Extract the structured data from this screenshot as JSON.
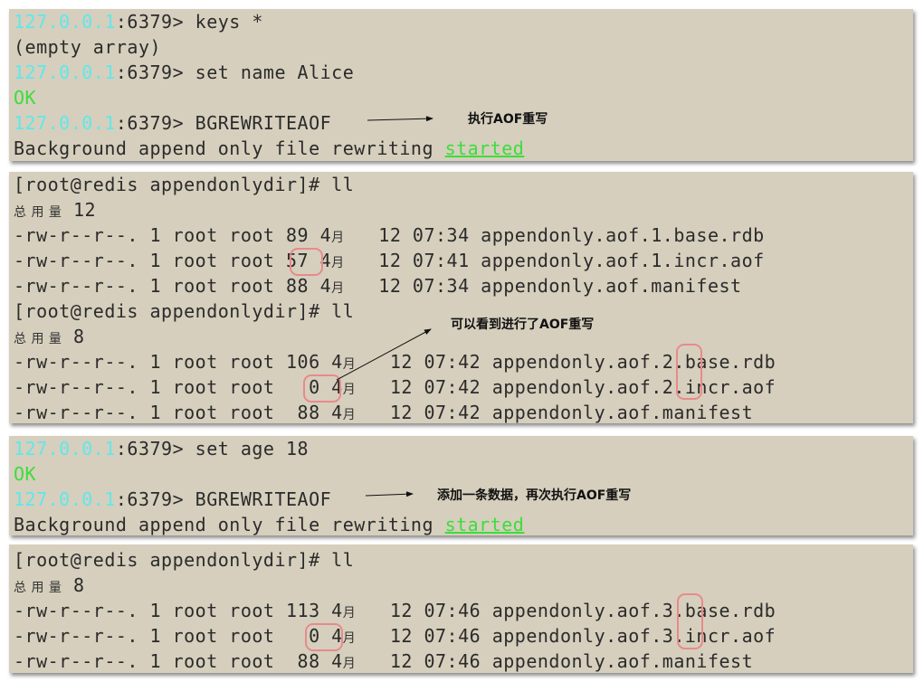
{
  "panel1": {
    "l1": {
      "ip": "127.0.0.1",
      "rest": ":6379> keys *"
    },
    "l2": "(empty array)",
    "l3": {
      "ip": "127.0.0.1",
      "rest": ":6379> set name Alice"
    },
    "l4": "OK",
    "l5": {
      "ip": "127.0.0.1",
      "rest": ":6379> BGREWRITEAOF"
    },
    "l6": {
      "text": "Background append only file rewriting ",
      "started": "started"
    }
  },
  "panel2": {
    "prompt1": "[root@redis appendonlydir]# ll",
    "total1": {
      "label": "总 用 量",
      "num": " 12"
    },
    "f1": {
      "pre": "-rw-r--r--. 1 root root 89 4",
      "mon": "月",
      "post": "   12 07:34 appendonly.aof.1.base.rdb"
    },
    "f2": {
      "pre": "-rw-r--r--. 1 root root 57 4",
      "mon": "月",
      "post": "   12 07:41 appendonly.aof.1.incr.aof"
    },
    "f3": {
      "pre": "-rw-r--r--. 1 root root 88 4",
      "mon": "月",
      "post": "   12 07:34 appendonly.aof.manifest"
    },
    "prompt2": "[root@redis appendonlydir]# ll",
    "total2": {
      "label": "总 用 量",
      "num": " 8"
    },
    "f4": {
      "pre": "-rw-r--r--. 1 root root 106 4",
      "mon": "月",
      "post": "   12 07:42 appendonly.aof.2.base.rdb"
    },
    "f5": {
      "pre": "-rw-r--r--. 1 root root   0 4",
      "mon": "月",
      "post": "   12 07:42 appendonly.aof.2.incr.aof"
    },
    "f6": {
      "pre": "-rw-r--r--. 1 root root  88 4",
      "mon": "月",
      "post": "   12 07:42 appendonly.aof.manifest"
    }
  },
  "panel3": {
    "l1": {
      "ip": "127.0.0.1",
      "rest": ":6379> set age 18"
    },
    "l2": "OK",
    "l3": {
      "ip": "127.0.0.1",
      "rest": ":6379> BGREWRITEAOF"
    },
    "l4": {
      "text": "Background append only file rewriting ",
      "started": "started"
    }
  },
  "panel4": {
    "prompt": "[root@redis appendonlydir]# ll",
    "total": {
      "label": "总 用 量",
      "num": " 8"
    },
    "f1": {
      "pre": "-rw-r--r--. 1 root root 113 4",
      "mon": "月",
      "post": "   12 07:46 appendonly.aof.3.base.rdb"
    },
    "f2": {
      "pre": "-rw-r--r--. 1 root root   0 4",
      "mon": "月",
      "post": "   12 07:46 appendonly.aof.3.incr.aof"
    },
    "f3": {
      "pre": "-rw-r--r--. 1 root root  88 4",
      "mon": "月",
      "post": "   12 07:46 appendonly.aof.manifest"
    }
  },
  "annotations": {
    "a1": "执行AOF重写",
    "a2": "可以看到进行了AOF重写",
    "a3": "添加一条数据，再次执行AOF重写"
  },
  "colors": {
    "background": "#d6cfbd",
    "ip": "#5ee8ec",
    "ok": "#3ddc3d",
    "highlight": "#e88a8a"
  }
}
